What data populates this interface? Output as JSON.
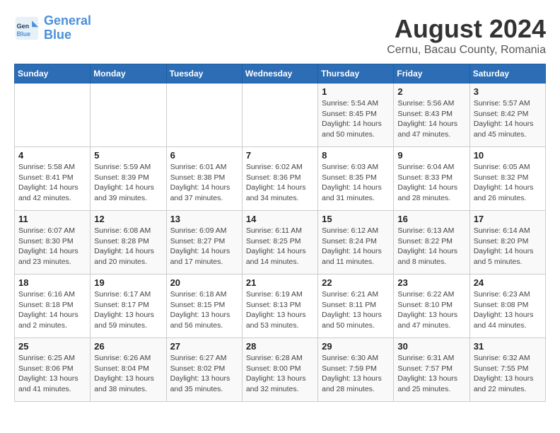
{
  "header": {
    "logo_line1": "General",
    "logo_line2": "Blue",
    "title": "August 2024",
    "subtitle": "Cernu, Bacau County, Romania"
  },
  "weekdays": [
    "Sunday",
    "Monday",
    "Tuesday",
    "Wednesday",
    "Thursday",
    "Friday",
    "Saturday"
  ],
  "weeks": [
    [
      {
        "day": "",
        "info": ""
      },
      {
        "day": "",
        "info": ""
      },
      {
        "day": "",
        "info": ""
      },
      {
        "day": "",
        "info": ""
      },
      {
        "day": "1",
        "info": "Sunrise: 5:54 AM\nSunset: 8:45 PM\nDaylight: 14 hours and 50 minutes."
      },
      {
        "day": "2",
        "info": "Sunrise: 5:56 AM\nSunset: 8:43 PM\nDaylight: 14 hours and 47 minutes."
      },
      {
        "day": "3",
        "info": "Sunrise: 5:57 AM\nSunset: 8:42 PM\nDaylight: 14 hours and 45 minutes."
      }
    ],
    [
      {
        "day": "4",
        "info": "Sunrise: 5:58 AM\nSunset: 8:41 PM\nDaylight: 14 hours and 42 minutes."
      },
      {
        "day": "5",
        "info": "Sunrise: 5:59 AM\nSunset: 8:39 PM\nDaylight: 14 hours and 39 minutes."
      },
      {
        "day": "6",
        "info": "Sunrise: 6:01 AM\nSunset: 8:38 PM\nDaylight: 14 hours and 37 minutes."
      },
      {
        "day": "7",
        "info": "Sunrise: 6:02 AM\nSunset: 8:36 PM\nDaylight: 14 hours and 34 minutes."
      },
      {
        "day": "8",
        "info": "Sunrise: 6:03 AM\nSunset: 8:35 PM\nDaylight: 14 hours and 31 minutes."
      },
      {
        "day": "9",
        "info": "Sunrise: 6:04 AM\nSunset: 8:33 PM\nDaylight: 14 hours and 28 minutes."
      },
      {
        "day": "10",
        "info": "Sunrise: 6:05 AM\nSunset: 8:32 PM\nDaylight: 14 hours and 26 minutes."
      }
    ],
    [
      {
        "day": "11",
        "info": "Sunrise: 6:07 AM\nSunset: 8:30 PM\nDaylight: 14 hours and 23 minutes."
      },
      {
        "day": "12",
        "info": "Sunrise: 6:08 AM\nSunset: 8:28 PM\nDaylight: 14 hours and 20 minutes."
      },
      {
        "day": "13",
        "info": "Sunrise: 6:09 AM\nSunset: 8:27 PM\nDaylight: 14 hours and 17 minutes."
      },
      {
        "day": "14",
        "info": "Sunrise: 6:11 AM\nSunset: 8:25 PM\nDaylight: 14 hours and 14 minutes."
      },
      {
        "day": "15",
        "info": "Sunrise: 6:12 AM\nSunset: 8:24 PM\nDaylight: 14 hours and 11 minutes."
      },
      {
        "day": "16",
        "info": "Sunrise: 6:13 AM\nSunset: 8:22 PM\nDaylight: 14 hours and 8 minutes."
      },
      {
        "day": "17",
        "info": "Sunrise: 6:14 AM\nSunset: 8:20 PM\nDaylight: 14 hours and 5 minutes."
      }
    ],
    [
      {
        "day": "18",
        "info": "Sunrise: 6:16 AM\nSunset: 8:18 PM\nDaylight: 14 hours and 2 minutes."
      },
      {
        "day": "19",
        "info": "Sunrise: 6:17 AM\nSunset: 8:17 PM\nDaylight: 13 hours and 59 minutes."
      },
      {
        "day": "20",
        "info": "Sunrise: 6:18 AM\nSunset: 8:15 PM\nDaylight: 13 hours and 56 minutes."
      },
      {
        "day": "21",
        "info": "Sunrise: 6:19 AM\nSunset: 8:13 PM\nDaylight: 13 hours and 53 minutes."
      },
      {
        "day": "22",
        "info": "Sunrise: 6:21 AM\nSunset: 8:11 PM\nDaylight: 13 hours and 50 minutes."
      },
      {
        "day": "23",
        "info": "Sunrise: 6:22 AM\nSunset: 8:10 PM\nDaylight: 13 hours and 47 minutes."
      },
      {
        "day": "24",
        "info": "Sunrise: 6:23 AM\nSunset: 8:08 PM\nDaylight: 13 hours and 44 minutes."
      }
    ],
    [
      {
        "day": "25",
        "info": "Sunrise: 6:25 AM\nSunset: 8:06 PM\nDaylight: 13 hours and 41 minutes."
      },
      {
        "day": "26",
        "info": "Sunrise: 6:26 AM\nSunset: 8:04 PM\nDaylight: 13 hours and 38 minutes."
      },
      {
        "day": "27",
        "info": "Sunrise: 6:27 AM\nSunset: 8:02 PM\nDaylight: 13 hours and 35 minutes."
      },
      {
        "day": "28",
        "info": "Sunrise: 6:28 AM\nSunset: 8:00 PM\nDaylight: 13 hours and 32 minutes."
      },
      {
        "day": "29",
        "info": "Sunrise: 6:30 AM\nSunset: 7:59 PM\nDaylight: 13 hours and 28 minutes."
      },
      {
        "day": "30",
        "info": "Sunrise: 6:31 AM\nSunset: 7:57 PM\nDaylight: 13 hours and 25 minutes."
      },
      {
        "day": "31",
        "info": "Sunrise: 6:32 AM\nSunset: 7:55 PM\nDaylight: 13 hours and 22 minutes."
      }
    ]
  ]
}
